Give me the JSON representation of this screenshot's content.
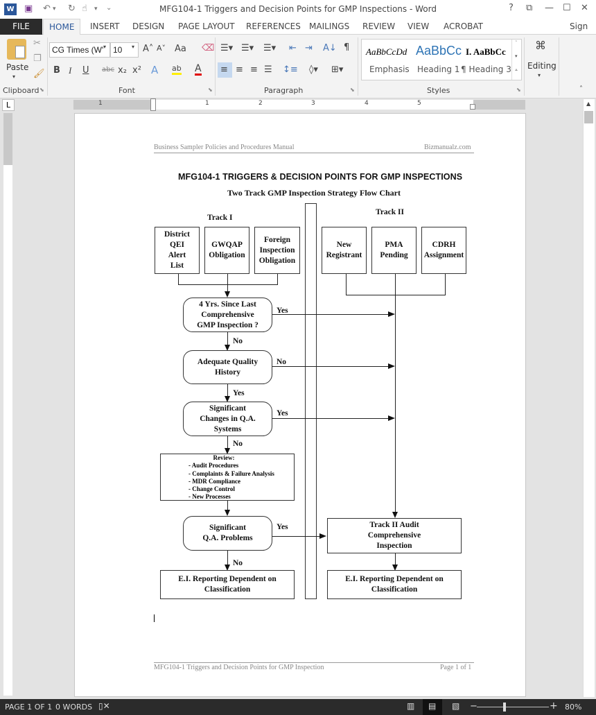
{
  "window": {
    "title": "MFG104-1 Triggers and Decision Points for GMP Inspections - Word",
    "help": "?",
    "ribbon_display": "⧉",
    "minimize": "—",
    "maximize": "☐",
    "close": "✕"
  },
  "quick_access": {
    "save": "💾",
    "undo": "↶",
    "undo_dd": "▾",
    "redo": "↻",
    "touch": "☝",
    "touch_dd": "▾",
    "customize": "⌄"
  },
  "tabs": [
    {
      "label": "FILE"
    },
    {
      "label": "HOME"
    },
    {
      "label": "INSERT"
    },
    {
      "label": "DESIGN"
    },
    {
      "label": "PAGE LAYOUT"
    },
    {
      "label": "REFERENCES"
    },
    {
      "label": "MAILINGS"
    },
    {
      "label": "REVIEW"
    },
    {
      "label": "VIEW"
    },
    {
      "label": "ACROBAT"
    }
  ],
  "sign_in": "Sign in",
  "ribbon": {
    "clipboard": {
      "paste": "Paste",
      "label": "Clipboard"
    },
    "font": {
      "name": "CG Times (W'",
      "size": "10",
      "label": "Font",
      "bold": "B",
      "italic": "I",
      "underline": "U",
      "strike": "abc",
      "sub": "x₂",
      "sup": "x²",
      "grow": "A˄",
      "shrink": "A˅",
      "case": "Aa",
      "effects": "A",
      "highlight": "ab",
      "color": "A"
    },
    "paragraph": {
      "label": "Paragraph",
      "sort": "A↓",
      "pilcrow": "¶"
    },
    "styles": {
      "label": "Styles",
      "items": [
        {
          "preview": "AaBbCcDd",
          "name": "Emphasis"
        },
        {
          "preview": "AaBbCc",
          "name": "Heading 1"
        },
        {
          "preview": "I. AaBbCc",
          "name": "¶ Heading 3"
        }
      ]
    },
    "editing": {
      "label": "Editing"
    }
  },
  "ruler": {
    "numbers": [
      "1",
      "1",
      "2",
      "3",
      "4",
      "5"
    ],
    "tab_selector": "L"
  },
  "document": {
    "header_left": "Business Sampler Policies and Procedures Manual",
    "header_right": "Bizmanualz.com",
    "title": "MFG104-1  TRIGGERS & DECISION POINTS FOR GMP INSPECTIONS",
    "subtitle": "Two Track GMP Inspection Strategy Flow Chart",
    "footer_left": "MFG104-1 Triggers and Decision Points for GMP Inspection",
    "footer_right": "Page 1 of 1",
    "flowchart": {
      "track1": "Track I",
      "track2": "Track II",
      "t1_boxes": [
        "District\nQEI\nAlert\nList",
        "GWQAP\nObligation",
        "Foreign\nInspection\nObligation"
      ],
      "t2_boxes": [
        "New\nRegistrant",
        "PMA\nPending",
        "CDRH\nAssignment"
      ],
      "decision1": "4 Yrs. Since Last\nComprehensive\nGMP Inspection ?",
      "decision2": "Adequate Quality\nHistory",
      "decision3": "Significant\nChanges in Q.A.\nSystems",
      "review_title": "Review:",
      "review_items": [
        "- Audit Procedures",
        "- Complaints & Failure  Analysis",
        "- MDR Compliance",
        "- Change Control",
        "- New Processes"
      ],
      "decision4": "Significant\nQ.A. Problems",
      "end_left": "E.I. Reporting Dependent on\nClassification",
      "audit": "Track II Audit\nComprehensive\nInspection",
      "end_right": "E.I. Reporting Dependent on\nClassification",
      "labels": {
        "d1_yes": "Yes",
        "d1_no": "No",
        "d2_no": "No",
        "d2_yes": "Yes",
        "d3_yes": "Yes",
        "d3_no": "No",
        "d4_yes": "Yes",
        "d4_no": "No"
      }
    }
  },
  "status_bar": {
    "page": "PAGE 1 OF 1",
    "words": "0 WORDS",
    "zoom": "80%",
    "zoom_minus": "−",
    "zoom_plus": "+",
    "zoom_level_percent": 80
  }
}
